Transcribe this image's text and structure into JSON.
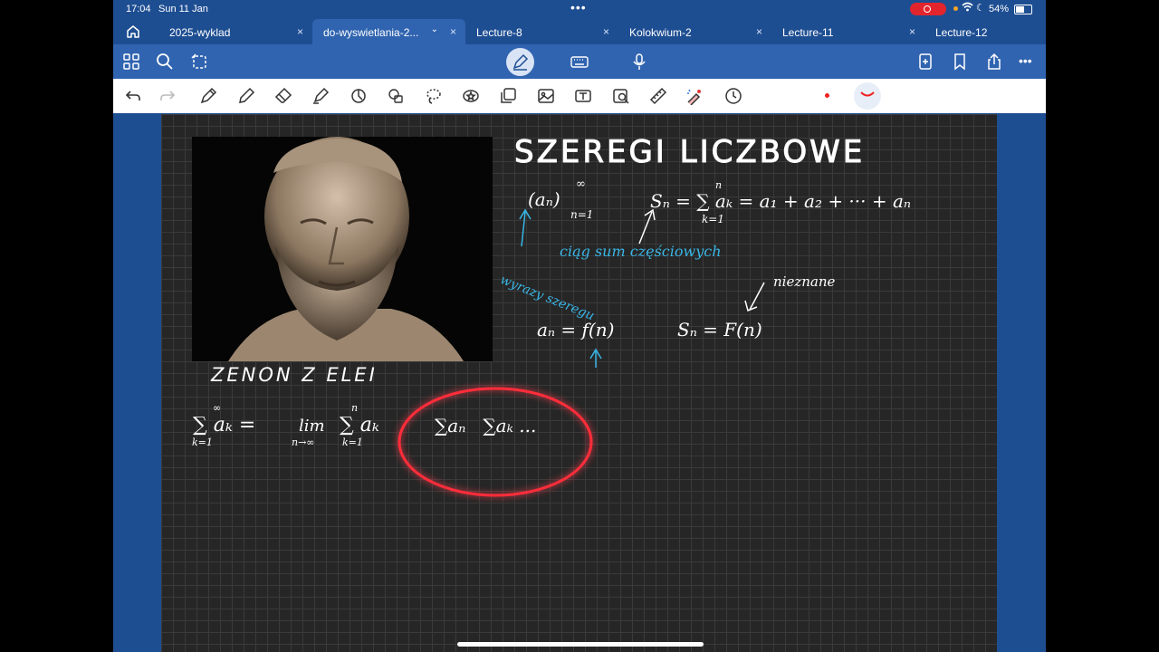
{
  "status": {
    "time": "17:04",
    "date": "Sun 11 Jan",
    "battery": "54%",
    "battery_level": 0.54
  },
  "tabs": [
    {
      "label": "2025-wyklad"
    },
    {
      "label": "do-wyswietlania-2..."
    },
    {
      "label": "Lecture-8"
    },
    {
      "label": "Kolokwium-2"
    },
    {
      "label": "Lecture-11"
    },
    {
      "label": "Lecture-12"
    }
  ],
  "close_glyph": "×",
  "chevron_glyph": "⌄",
  "more_glyph": "•••",
  "note": {
    "title": "SZEREGI LICZBOWE",
    "caption": "ZENON Z ELEI",
    "seq": "(aₙ)",
    "seq_top": "∞",
    "seq_sub": "n=1",
    "partial_sum": "Sₙ = ∑ aₖ = a₁ + a₂ + ··· + aₙ",
    "partial_sum_top": "n",
    "partial_sum_sub": "k=1",
    "label_partial": "ciąg sum częściowych",
    "label_terms": "wyrazy szeregu",
    "an_formula": "aₙ = f(n)",
    "sn_formula": "Sₙ = F(n)",
    "label_unknown": "nieznane",
    "limit_lhs": "∑ aₖ =",
    "lhs_top": "∞",
    "lhs_sub": "k=1",
    "limit_lim": "lim",
    "limit_lim_sub": "n→∞",
    "limit_rhs": "∑ aₖ",
    "rhs_top": "n",
    "rhs_sub": "k=1",
    "circled": "∑aₙ   ∑aₖ ..."
  }
}
